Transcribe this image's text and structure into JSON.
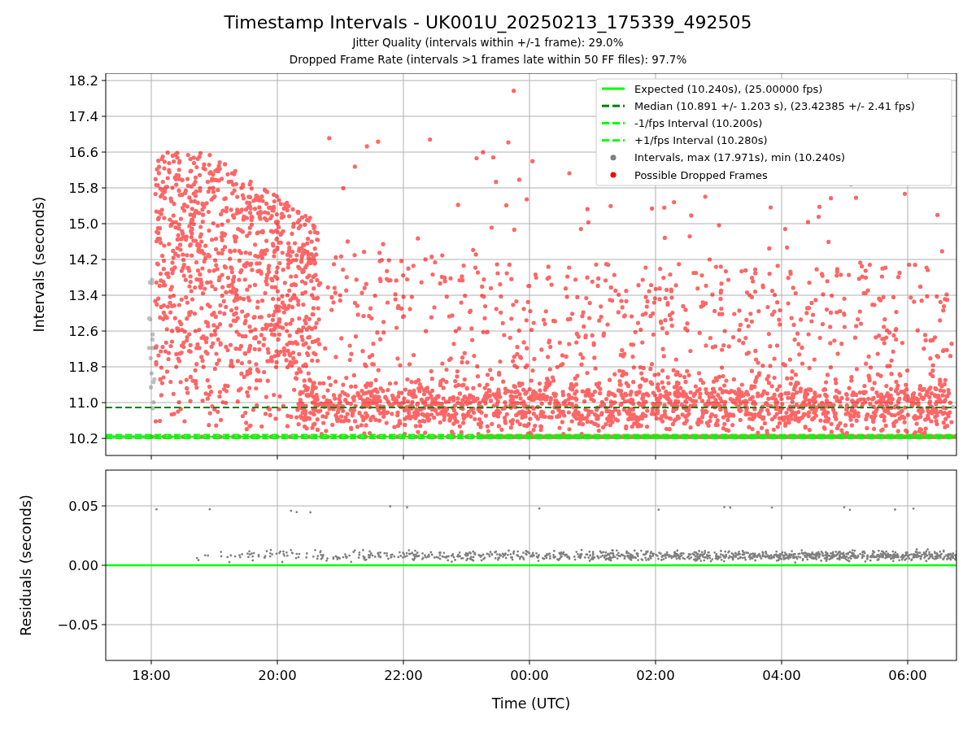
{
  "title": "Timestamp Intervals - UK001U_20250213_175339_492505",
  "subtitles": [
    "Jitter Quality (intervals within +/-1 frame): 29.0%",
    "Dropped Frame Rate (intervals >1 frames late within 50 FF files): 97.7%"
  ],
  "intervals_plot": {
    "ylabel": "Intervals (seconds)",
    "y_tick_labels": [
      "18.2",
      "17.4",
      "16.6",
      "15.8",
      "15.0",
      "14.2",
      "13.4",
      "12.6",
      "11.8",
      "11.0",
      "10.2"
    ],
    "legend": [
      {
        "label": "Expected (10.240s), (25.00000 fps)",
        "color": "#00ff00",
        "kind": "solid"
      },
      {
        "label": "Median (10.891 +/- 1.203 s), (23.42385 +/- 2.41 fps)",
        "color": "#008000",
        "kind": "dashed"
      },
      {
        "label": "-1/fps Interval (10.200s)",
        "color": "#00ff00",
        "kind": "dashed"
      },
      {
        "label": "+1/fps Interval (10.280s)",
        "color": "#00ff00",
        "kind": "dashed"
      },
      {
        "label": "Intervals, max (17.971s), min (10.240s)",
        "color": "#808080",
        "kind": "points"
      },
      {
        "label": "Possible Dropped Frames",
        "color": "#ff0000",
        "kind": "points"
      }
    ]
  },
  "residuals_plot": {
    "ylabel": "Residuals (seconds)",
    "xlabel": "Time (UTC)",
    "x_tick_labels": [
      "18:00",
      "20:00",
      "22:00",
      "00:00",
      "02:00",
      "04:00",
      "06:00"
    ],
    "y_tick_labels": [
      "0.05",
      "0.00",
      "−0.05"
    ]
  }
}
